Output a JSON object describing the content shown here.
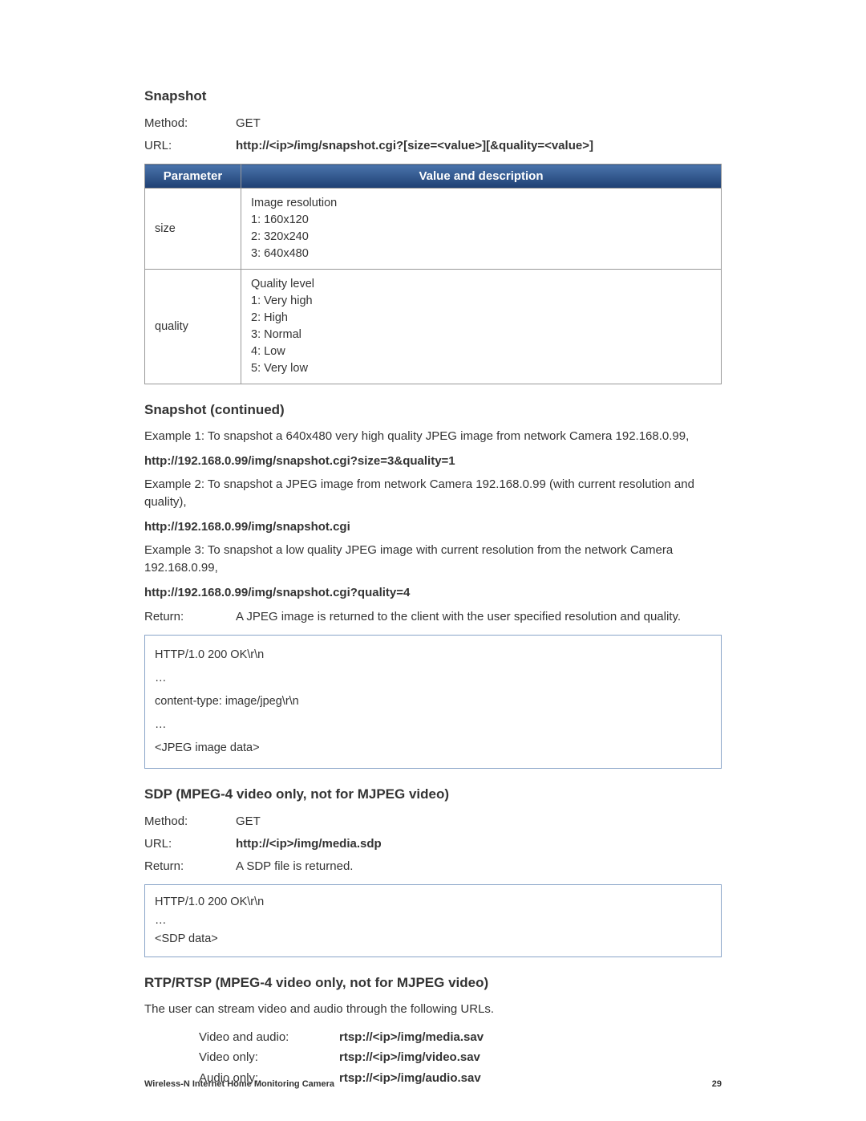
{
  "snapshot": {
    "title": "Snapshot",
    "methodLabel": "Method:",
    "methodValue": "GET",
    "urlLabel": "URL:",
    "urlValue": "http://<ip>/img/snapshot.cgi?[size=<value>][&quality=<value>]",
    "table": {
      "headerParam": "Parameter",
      "headerDesc": "Value and description",
      "rows": [
        {
          "param": "size",
          "desc": "Image resolution\n1:  160x120\n2:  320x240\n3:  640x480"
        },
        {
          "param": "quality",
          "desc": "Quality level\n1:  Very high\n2:  High\n3:  Normal\n4:  Low\n5:  Very low"
        }
      ]
    }
  },
  "snapshotCont": {
    "title": "Snapshot (continued)",
    "ex1": "Example 1: To snapshot a 640x480 very high quality JPEG image from network Camera 192.168.0.99,",
    "url1": "http://192.168.0.99/img/snapshot.cgi?size=3&quality=1",
    "ex2": "Example 2: To snapshot a JPEG image from network Camera 192.168.0.99 (with current resolution and quality),",
    "url2": "http://192.168.0.99/img/snapshot.cgi",
    "ex3": "Example 3: To snapshot a low quality JPEG image with current resolution from the network Camera 192.168.0.99,",
    "url3": "http://192.168.0.99/img/snapshot.cgi?quality=4",
    "returnLabel": "Return:",
    "returnValue": "A JPEG image is returned to the client with the user specified resolution and quality.",
    "responseLines": [
      "HTTP/1.0 200 OK\\r\\n",
      "…",
      "content-type: image/jpeg\\r\\n",
      "…",
      "<JPEG image data>"
    ]
  },
  "sdp": {
    "title": "SDP (MPEG-4 video only, not for MJPEG video)",
    "methodLabel": "Method:",
    "methodValue": "GET",
    "urlLabel": "URL:",
    "urlValue": "http://<ip>/img/media.sdp",
    "returnLabel": "Return:",
    "returnValue": "A SDP file is returned.",
    "responseLines": [
      "HTTP/1.0 200 OK\\r\\n",
      "…",
      "<SDP data>"
    ]
  },
  "rtsp": {
    "title": "RTP/RTSP (MPEG-4 video only, not for MJPEG video)",
    "intro": "The user can stream video and audio through the following URLs.",
    "rows": [
      {
        "label": "Video and audio:",
        "url": "rtsp://<ip>/img/media.sav"
      },
      {
        "label": "Video only:",
        "url": "rtsp://<ip>/img/video.sav"
      },
      {
        "label": "Audio only:",
        "url": "rtsp://<ip>/img/audio.sav"
      }
    ]
  },
  "footer": {
    "title": "Wireless-N Internet Home Monitoring Camera",
    "page": "29"
  }
}
